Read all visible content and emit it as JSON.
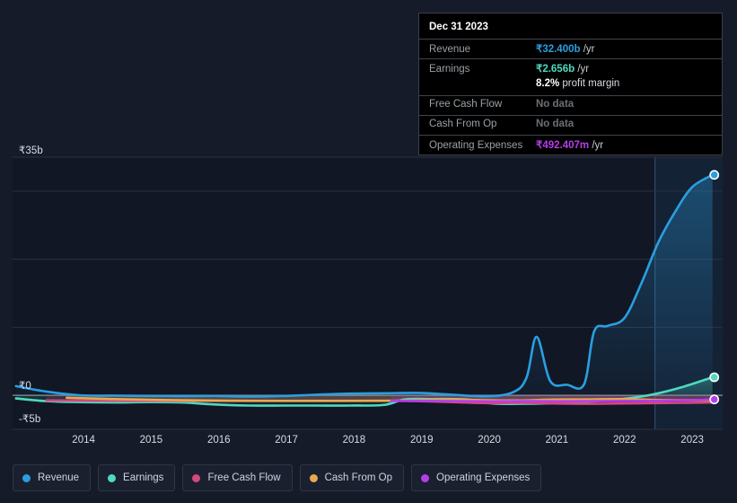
{
  "chart_data": {
    "type": "line",
    "title": "",
    "xlabel": "",
    "ylabel": "",
    "currency_symbol": "₹",
    "ylim": [
      -5,
      35
    ],
    "yticks": [
      35,
      0,
      -5
    ],
    "ytick_labels": [
      "₹35b",
      "₹0",
      "-₹5b"
    ],
    "gridlines": [
      35,
      30,
      20,
      10,
      0
    ],
    "grid": true,
    "legend_position": "bottom-left",
    "x": [
      "2014",
      "2015",
      "2016",
      "2017",
      "2018",
      "2019",
      "2020",
      "2021",
      "2022",
      "2023"
    ],
    "xticks": [
      "2014",
      "2015",
      "2016",
      "2017",
      "2018",
      "2019",
      "2020",
      "2021",
      "2022",
      "2023"
    ],
    "units": "billions INR",
    "highlight_band_start": "2023",
    "series": [
      {
        "name": "Revenue",
        "color": "#2a9fe0",
        "final_value": 32.4,
        "final_label": "₹32.400b",
        "points": [
          [
            2013.55,
            1.35
          ],
          [
            2014.0,
            0.55
          ],
          [
            2014.5,
            0.0
          ],
          [
            2015.0,
            -0.05
          ],
          [
            2015.5,
            -0.1
          ],
          [
            2016.0,
            -0.12
          ],
          [
            2016.5,
            -0.1
          ],
          [
            2017.0,
            -0.18
          ],
          [
            2017.5,
            -0.1
          ],
          [
            2018.0,
            0.1
          ],
          [
            2018.5,
            0.25
          ],
          [
            2019.0,
            0.3
          ],
          [
            2019.5,
            0.35
          ],
          [
            2020.0,
            0.1
          ],
          [
            2020.5,
            -0.15
          ],
          [
            2020.9,
            0.45
          ],
          [
            2021.1,
            2.6
          ],
          [
            2021.25,
            8.6
          ],
          [
            2021.45,
            2.1
          ],
          [
            2021.7,
            1.55
          ],
          [
            2021.95,
            1.6
          ],
          [
            2022.1,
            9.4
          ],
          [
            2022.3,
            10.2
          ],
          [
            2022.55,
            11.4
          ],
          [
            2022.8,
            16.5
          ],
          [
            2023.05,
            22.5
          ],
          [
            2023.3,
            27.0
          ],
          [
            2023.55,
            30.6
          ],
          [
            2023.85,
            32.4
          ]
        ]
      },
      {
        "name": "Earnings",
        "color": "#4fd9c0",
        "final_value": 2.656,
        "final_label": "₹2.656b",
        "points": [
          [
            2013.55,
            -0.45
          ],
          [
            2014.0,
            -0.85
          ],
          [
            2014.5,
            -1.0
          ],
          [
            2015.0,
            -1.05
          ],
          [
            2015.5,
            -1.0
          ],
          [
            2016.0,
            -1.05
          ],
          [
            2016.5,
            -1.35
          ],
          [
            2017.0,
            -1.5
          ],
          [
            2017.5,
            -1.5
          ],
          [
            2018.0,
            -1.5
          ],
          [
            2018.5,
            -1.5
          ],
          [
            2019.0,
            -1.4
          ],
          [
            2019.3,
            -0.6
          ],
          [
            2019.7,
            -0.55
          ],
          [
            2020.2,
            -0.6
          ],
          [
            2020.6,
            -1.2
          ],
          [
            2021.0,
            -1.25
          ],
          [
            2021.4,
            -1.2
          ],
          [
            2021.8,
            -1.05
          ],
          [
            2022.2,
            -0.8
          ],
          [
            2022.6,
            -0.45
          ],
          [
            2023.0,
            0.2
          ],
          [
            2023.4,
            1.2
          ],
          [
            2023.85,
            2.656
          ]
        ]
      },
      {
        "name": "Free Cash Flow",
        "color": "#d4477f",
        "final_value": null,
        "final_label": "No data",
        "points": [
          [
            2014.0,
            -0.75
          ],
          [
            2014.6,
            -0.78
          ],
          [
            2015.2,
            -0.8
          ],
          [
            2016.0,
            -0.82
          ],
          [
            2017.0,
            -0.82
          ],
          [
            2018.0,
            -0.8
          ],
          [
            2019.0,
            -0.8
          ],
          [
            2019.5,
            -0.85
          ],
          [
            2020.0,
            -1.0
          ],
          [
            2020.6,
            -1.15
          ],
          [
            2021.0,
            -1.1
          ],
          [
            2021.5,
            -1.2
          ],
          [
            2022.0,
            -1.25
          ],
          [
            2022.5,
            -1.2
          ],
          [
            2023.0,
            -1.15
          ],
          [
            2023.5,
            -1.1
          ],
          [
            2023.85,
            -1.05
          ]
        ]
      },
      {
        "name": "Cash From Op",
        "color": "#e8a94e",
        "final_value": null,
        "final_label": "No data",
        "points": [
          [
            2014.3,
            -0.35
          ],
          [
            2015.0,
            -0.55
          ],
          [
            2016.0,
            -0.72
          ],
          [
            2017.0,
            -0.8
          ],
          [
            2018.0,
            -0.82
          ],
          [
            2019.0,
            -0.8
          ],
          [
            2019.5,
            -0.72
          ],
          [
            2020.0,
            -0.6
          ],
          [
            2020.5,
            -0.72
          ],
          [
            2021.0,
            -0.75
          ],
          [
            2021.5,
            -0.62
          ],
          [
            2022.0,
            -0.6
          ],
          [
            2022.5,
            -0.55
          ],
          [
            2023.0,
            -0.68
          ],
          [
            2023.5,
            -0.72
          ],
          [
            2023.85,
            -0.7
          ]
        ]
      },
      {
        "name": "Operating Expenses",
        "color": "#b43fe8",
        "final_value": 0.492407,
        "final_label": "₹492.407m",
        "points": [
          [
            2019.1,
            -0.82
          ],
          [
            2019.6,
            -0.82
          ],
          [
            2020.1,
            -0.85
          ],
          [
            2020.6,
            -0.88
          ],
          [
            2021.1,
            -0.85
          ],
          [
            2021.6,
            -0.88
          ],
          [
            2022.1,
            -0.85
          ],
          [
            2022.6,
            -0.82
          ],
          [
            2023.1,
            -0.78
          ],
          [
            2023.5,
            -0.72
          ],
          [
            2023.85,
            -0.6
          ]
        ]
      }
    ]
  },
  "tooltip": {
    "title": "Dec 31 2023",
    "rows": [
      {
        "key": "Revenue",
        "value": "₹32.400b",
        "unit": "/yr",
        "color": "#2a9fe0",
        "nodata": false
      },
      {
        "key": "Earnings",
        "value": "₹2.656b",
        "unit": "/yr",
        "color": "#4fd9c0",
        "nodata": false
      },
      {
        "key": "",
        "value": "8.2%",
        "unit": "profit margin",
        "color": "#ffffff",
        "nodata": false,
        "sub": true
      },
      {
        "key": "Free Cash Flow",
        "value": "No data",
        "unit": "",
        "color": "#6b7076",
        "nodata": true
      },
      {
        "key": "Cash From Op",
        "value": "No data",
        "unit": "",
        "color": "#6b7076",
        "nodata": true
      },
      {
        "key": "Operating Expenses",
        "value": "₹492.407m",
        "unit": "/yr",
        "color": "#b43fe8",
        "nodata": false
      }
    ]
  },
  "legend": {
    "items": [
      {
        "label": "Revenue",
        "color": "#2a9fe0"
      },
      {
        "label": "Earnings",
        "color": "#4fd9c0"
      },
      {
        "label": "Free Cash Flow",
        "color": "#d4477f"
      },
      {
        "label": "Cash From Op",
        "color": "#e8a94e"
      },
      {
        "label": "Operating Expenses",
        "color": "#b43fe8"
      }
    ]
  },
  "theme": {
    "background": "#151b28",
    "plot_background": "#111725",
    "gridline": "#2b3240",
    "zero_line": "#8a8f96",
    "axis_text": "#d8dde6",
    "highlight_band": "#1b2c3f"
  }
}
